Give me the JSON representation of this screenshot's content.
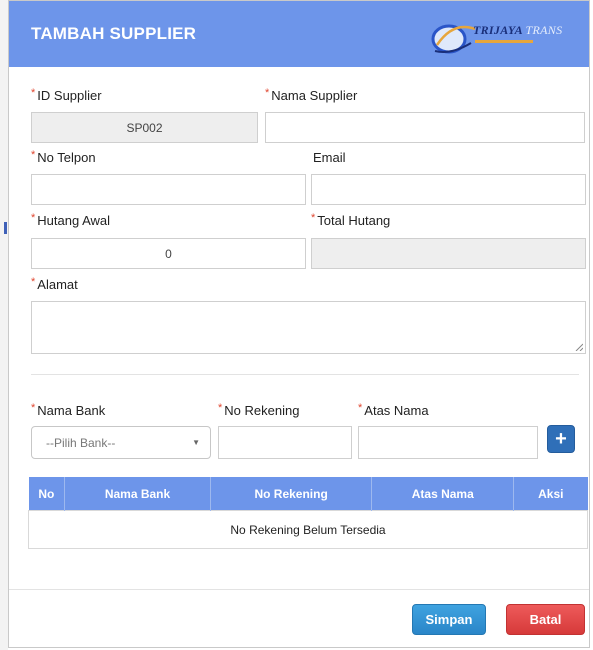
{
  "header": {
    "title": "TAMBAH SUPPLIER",
    "logo_brand": "TRIJAYA",
    "logo_brand_suffix": "TRANS"
  },
  "form": {
    "required_mark": "*",
    "id_supplier": {
      "label": "ID Supplier",
      "value": "SP002"
    },
    "nama_supplier": {
      "label": "Nama Supplier",
      "value": ""
    },
    "no_telpon": {
      "label": "No Telpon",
      "value": ""
    },
    "email": {
      "label": "Email",
      "value": ""
    },
    "hutang_awal": {
      "label": "Hutang Awal",
      "value": "0"
    },
    "total_hutang": {
      "label": "Total Hutang",
      "value": ""
    },
    "alamat": {
      "label": "Alamat",
      "value": ""
    }
  },
  "bank_form": {
    "nama_bank": {
      "label": "Nama Bank",
      "selected": "--Pilih Bank--"
    },
    "no_rekening": {
      "label": "No Rekening",
      "value": ""
    },
    "atas_nama": {
      "label": "Atas Nama",
      "value": ""
    },
    "add_label": "+"
  },
  "table": {
    "headers": [
      "No",
      "Nama Bank",
      "No Rekening",
      "Atas Nama",
      "Aksi"
    ],
    "empty_message": "No Rekening Belum Tersedia"
  },
  "footer": {
    "save_label": "Simpan",
    "cancel_label": "Batal"
  },
  "colors": {
    "header_bg": "#6d95ea",
    "save": "#2a86c8",
    "cancel": "#d63a3a",
    "required": "#e0452e"
  }
}
